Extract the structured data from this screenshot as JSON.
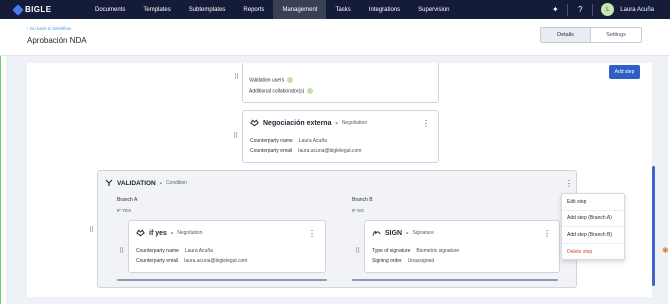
{
  "brand": {
    "name": "BIGLE"
  },
  "nav": {
    "items": [
      "Documents",
      "Templates",
      "Subtemplates",
      "Reports",
      "Management",
      "Tasks",
      "Integrations",
      "Supervision"
    ],
    "active": "Management"
  },
  "user": {
    "initial": "L",
    "name": "Laura Acuña"
  },
  "header": {
    "back_link": "Go back to Workflow",
    "title": "Aprobación NDA",
    "tabs": [
      "Details",
      "Settings"
    ],
    "active_tab": "Details"
  },
  "toolbar": {
    "add_step": "Add step"
  },
  "top_card": {
    "rows": [
      {
        "label": "Validation users"
      },
      {
        "label": "Additional collaborator(s)"
      }
    ]
  },
  "negotiation_card": {
    "title": "Negociación externa",
    "type": "Negotiation",
    "fields": [
      {
        "key": "Counterparty name",
        "value": "Laura Acuña"
      },
      {
        "key": "Counterparty email",
        "value": "laura.acuna@biglelegal.com"
      }
    ]
  },
  "condition": {
    "title": "VALIDATION",
    "type": "Condition",
    "branch_a": {
      "label": "Branch A",
      "rule": "IF YES"
    },
    "branch_b": {
      "label": "Branch B",
      "rule": "IF NO"
    }
  },
  "card_a": {
    "title": "if yes",
    "type": "Negotiation",
    "fields": [
      {
        "key": "Counterparty name",
        "value": "Laura Acuña"
      },
      {
        "key": "Counterparty email",
        "value": "laura.acuna@biglelegal.com"
      }
    ]
  },
  "card_b": {
    "title": "SIGN",
    "type": "Signature",
    "fields": [
      {
        "key": "Type of signature",
        "value": "Biometric signature"
      },
      {
        "key": "Signing order",
        "value": "Unassigned"
      }
    ]
  },
  "context_menu": {
    "items": [
      "Edit step",
      "Add step (Branch A)",
      "Add step (Branch B)",
      "Delete step"
    ]
  },
  "colors": {
    "nav_bg": "#141c3a",
    "primary": "#2f5fc4",
    "danger": "#d94437",
    "canvas_bg": "#eef1f6"
  }
}
